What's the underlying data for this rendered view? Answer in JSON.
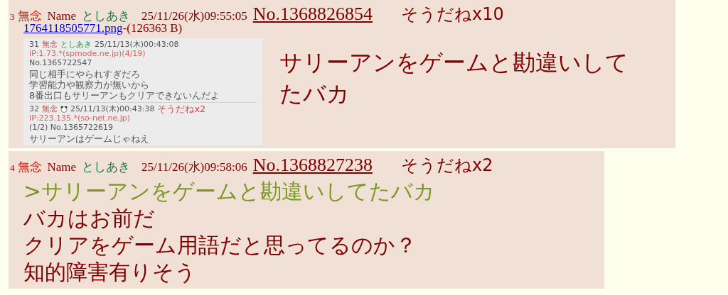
{
  "posts": [
    {
      "number": "3",
      "subject": "無念",
      "name_label": "Name",
      "name": "としあき",
      "date": "25/11/26(水)09:55:05",
      "post_no": "No.1368826854",
      "sodane": "そうだねx10",
      "file": {
        "name": "1764118505771.png",
        "size": "-(126363 B)"
      },
      "thumbnail": {
        "replies": [
          {
            "number": "31",
            "subject": "無念",
            "name": "としあき",
            "date": "25/11/13(木)00:43:08",
            "ip": "IP:1.73.*(spmode.ne.jp)(4/19)",
            "no": "No.1365722547",
            "lines": [
              "同じ相手にやられすぎだろ",
              "学習能力や観察力が無いから",
              "8番出口もサリーアンもクリアできないんだよ"
            ]
          },
          {
            "number": "32",
            "subject": "無念",
            "icon": true,
            "date": "25/11/13(木)00:43:38",
            "sodane": "そうだねx2",
            "ip": "IP:223.135.*(so-net.ne.jp)",
            "no": "(1/2) No.1365722619",
            "lines": [
              "サリーアンはゲームじゃねえ"
            ]
          }
        ]
      },
      "lines": [
        {
          "kind": "text",
          "text": "サリーアンをゲームと勘違いして"
        },
        {
          "kind": "text",
          "text": "たバカ"
        }
      ]
    },
    {
      "number": "4",
      "subject": "無念",
      "name_label": "Name",
      "name": "としあき",
      "date": "25/11/26(水)09:58:06",
      "post_no": "No.1368827238",
      "sodane": "そうだねx2",
      "lines": [
        {
          "kind": "quote",
          "text": ">サリーアンをゲームと勘違いしてたバカ"
        },
        {
          "kind": "text",
          "text": "バカはお前だ"
        },
        {
          "kind": "text",
          "text": "クリアをゲーム用語だと思ってるのか？"
        },
        {
          "kind": "text",
          "text": "知的障害有りそう"
        }
      ]
    }
  ]
}
